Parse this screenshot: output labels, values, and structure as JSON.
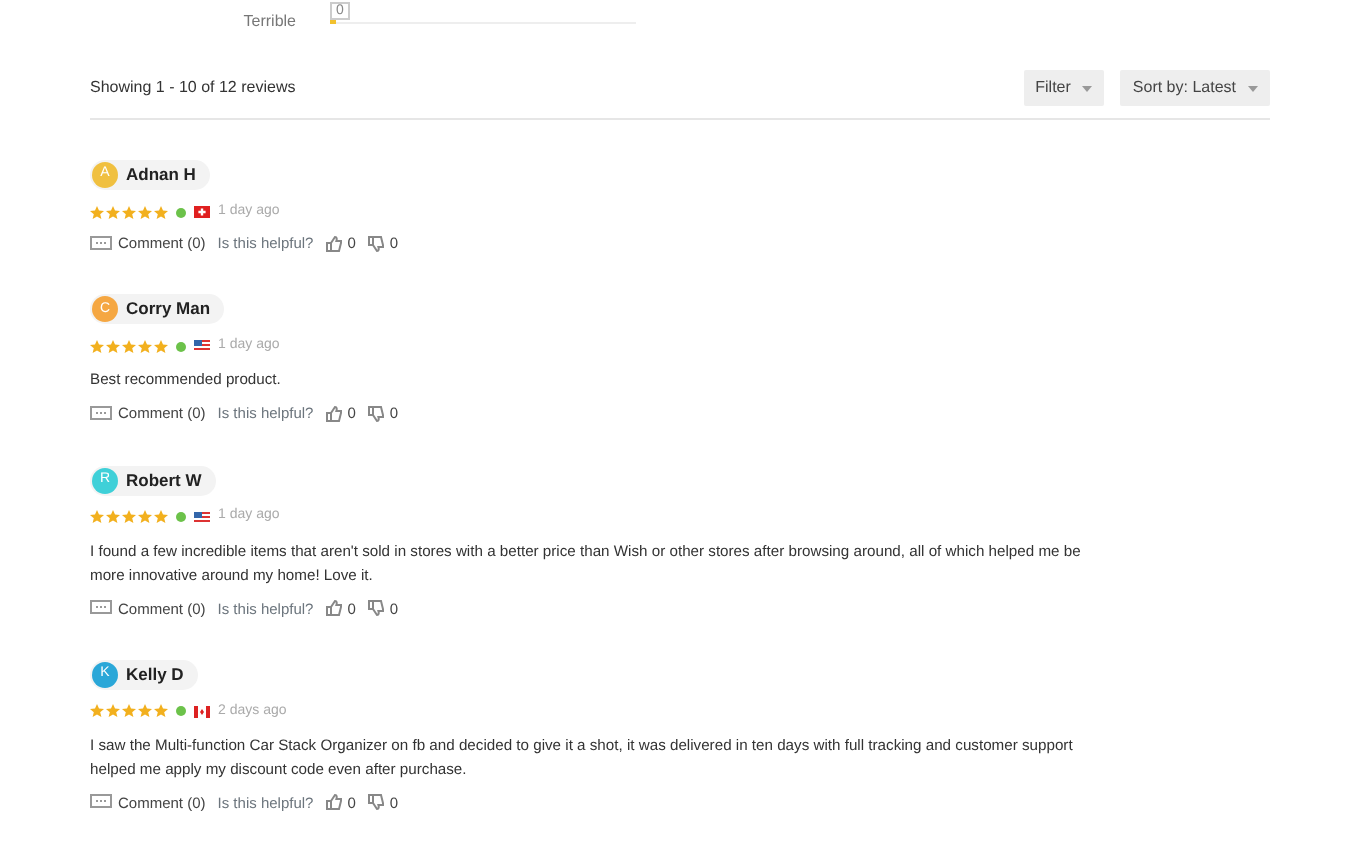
{
  "rating_rows": [
    {
      "label": "Terrible",
      "count": "0",
      "level": 0.02
    }
  ],
  "summary": "Showing 1 - 10 of 12 reviews",
  "buttons": [
    {
      "label": "Filter"
    },
    {
      "label": "Sort by: Latest"
    }
  ],
  "reviews": [
    {
      "initial": "A",
      "name": "Adnan H",
      "color": "#f0c040",
      "stars": 5,
      "verified": true,
      "kind": "ch",
      "time": "1 day ago",
      "comments": "Comment (0)",
      "helpful": "Is this helpful?",
      "likes": "0",
      "dislikes": "0"
    },
    {
      "initial": "C",
      "name": "Corry Man",
      "color": "#f5a742",
      "stars": 5,
      "verified": true,
      "kind": "us",
      "time": "1 day ago",
      "text": "Best recommended product.",
      "comments": "Comment (0)",
      "helpful": "Is this helpful?",
      "likes": "0",
      "dislikes": "0"
    },
    {
      "initial": "R",
      "name": "Robert W",
      "color": "#3fd0d8",
      "stars": 5,
      "verified": true,
      "kind": "us",
      "time": "1 day ago",
      "text": "I found a few incredible items that aren't sold in stores with a better price than Wish or other stores after browsing around, all of which helped me be more innovative around my home! Love it.",
      "comments": "Comment (0)",
      "helpful": "Is this helpful?",
      "likes": "0",
      "dislikes": "0"
    },
    {
      "initial": "K",
      "name": "Kelly D",
      "color": "#2aa7d8",
      "stars": 5,
      "verified": true,
      "kind": "ca",
      "time": "2 days ago",
      "text": "I saw the Multi-function Car Stack Organizer on fb and decided to give it a shot, it was delivered in ten days with full tracking and customer support helped me apply my discount code even after purchase.",
      "comments": "Comment (0)",
      "helpful": "Is this helpful?",
      "likes": "0",
      "dislikes": "0"
    }
  ]
}
